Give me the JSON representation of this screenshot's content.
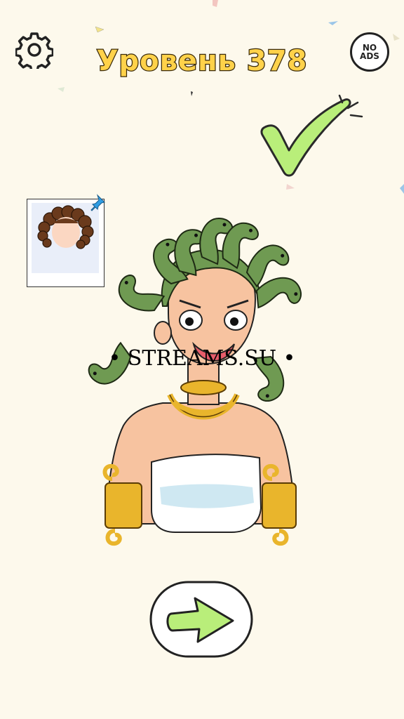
{
  "header": {
    "level_title": "Уровень 378",
    "no_ads_line1": "NO",
    "no_ads_line2": "ADS"
  },
  "watermark": "• STREAMS.SU •",
  "icons": {
    "settings": "gear-icon",
    "success": "checkmark-icon",
    "next": "arrow-right-icon",
    "hint_pin": "pin-icon"
  },
  "colors": {
    "background": "#fdf9ec",
    "title_fill": "#ffd24a",
    "check_green": "#b9ee7a",
    "snake_green": "#6f9a52",
    "gold": "#e9b52c"
  }
}
